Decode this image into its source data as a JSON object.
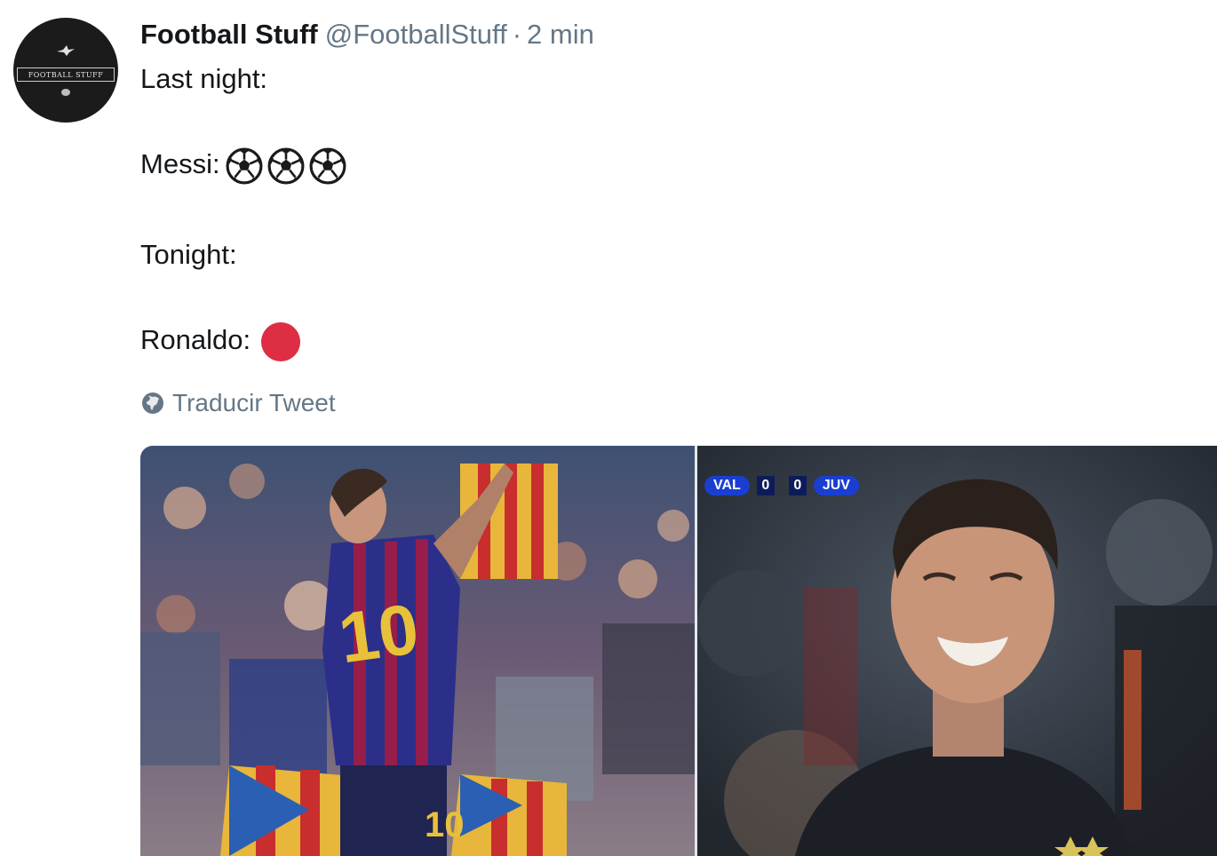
{
  "tweet": {
    "author": {
      "display_name": "Football Stuff",
      "handle": "@FootballStuff",
      "avatar_text": "FOOTBALL STUFF"
    },
    "separator": "·",
    "timestamp": "2 min",
    "lines": {
      "line1": "Last night:",
      "line2_label": "Messi:",
      "line2_emoji": "⚽⚽⚽",
      "line3": "Tonight:",
      "line4_label": "Ronaldo:",
      "line4_emoji": "🔴"
    },
    "translate_label": "Traducir Tweet",
    "media": {
      "photo_count": 2,
      "right_photo_scoreboard": {
        "home": "VAL",
        "home_score": "0",
        "away_score": "0",
        "away": "JUV"
      }
    }
  },
  "colors": {
    "text_primary": "#14171a",
    "text_secondary": "#657786",
    "red_circle": "#dd2e44",
    "scoreboard_blue": "#1a3fd0"
  },
  "icons": [
    "soccer-ball-icon",
    "red-circle-icon",
    "globe-icon"
  ]
}
